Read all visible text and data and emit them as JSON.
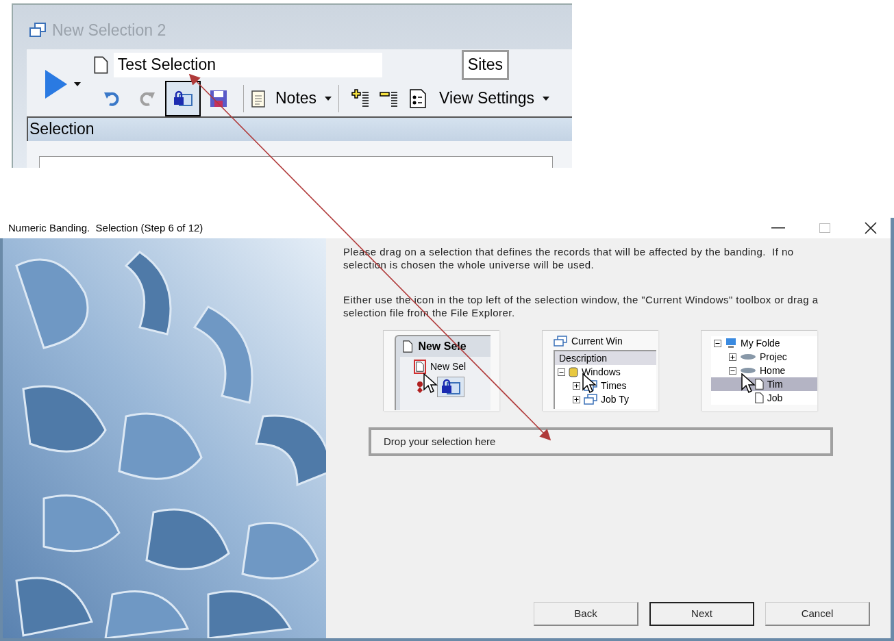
{
  "inset_window": {
    "title": "New Selection 2",
    "name_field": {
      "value": "Test Selection"
    },
    "sites_button": "Sites",
    "toolbar": [
      {
        "kind": "undo",
        "selected": false
      },
      {
        "kind": "redo",
        "selected": false
      },
      {
        "kind": "lock",
        "selected": true
      },
      {
        "kind": "save",
        "selected": false
      }
    ],
    "notes_button": "Notes",
    "view_settings_button": "View Settings",
    "panel_title": "Selection"
  },
  "dialog": {
    "title": "Numeric Banding.  Selection (Step 6 of 12)",
    "paragraphs": [
      "Please drag on a selection that defines the records that will be affected by the banding.  If no selection is chosen the whole universe will be used.",
      "Either use the icon in the top left of the selection window, the \"Current Windows\" toolbox or drag a selection file from the File Explorer."
    ],
    "examples": [
      {
        "kind": "window",
        "title": "New Sele",
        "item": "New Sel"
      },
      {
        "kind": "toolbox",
        "title": "Current Win",
        "column": "Description",
        "tree": [
          {
            "label": "Windows",
            "expanded": true,
            "selected": false,
            "children": [
              {
                "label": "Times",
                "expanded": false,
                "selected": false
              },
              {
                "label": "Job Ty",
                "expanded": false,
                "selected": false
              }
            ]
          }
        ]
      },
      {
        "kind": "explorer",
        "tree": [
          {
            "label": "My Folde",
            "expanded": true,
            "selected": false,
            "children": [
              {
                "label": "Projec",
                "expanded": false,
                "selected": false
              },
              {
                "label": "Home",
                "expanded": true,
                "selected": false,
                "children": [
                  {
                    "label": "Tim",
                    "selected": true
                  },
                  {
                    "label": "Job",
                    "selected": false
                  }
                ]
              }
            ]
          }
        ]
      }
    ],
    "drop_zone": {
      "label": "Drop your selection here"
    },
    "buttons": [
      {
        "label": "Back",
        "default": false
      },
      {
        "label": "Next",
        "default": true
      },
      {
        "label": "Cancel",
        "default": false
      }
    ]
  }
}
